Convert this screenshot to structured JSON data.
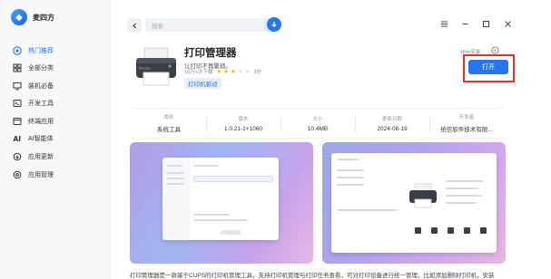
{
  "colors": {
    "accent": "#2775ee",
    "highlight_frame": "#e0302f",
    "star": "#f6b300"
  },
  "brand": {
    "name": "麦四方"
  },
  "sidebar": {
    "items": [
      {
        "label": "热门推荐",
        "icon": "star-badge-icon",
        "active": true
      },
      {
        "label": "全部分类",
        "icon": "grid-icon",
        "active": false
      },
      {
        "label": "装机必备",
        "icon": "monitor-icon",
        "active": false
      },
      {
        "label": "开发工具",
        "icon": "code-icon",
        "active": false
      },
      {
        "label": "终端应用",
        "icon": "terminal-icon",
        "active": false
      },
      {
        "label": "AI智能体",
        "icon": "ai-icon",
        "active": false
      },
      {
        "label": "应用更新",
        "icon": "refresh-icon",
        "active": false
      },
      {
        "label": "应用管理",
        "icon": "gear-icon",
        "active": false
      }
    ]
  },
  "topbar": {
    "search_placeholder": "搜索"
  },
  "app": {
    "name": "打印管理器",
    "description": "让打印不再繁琐。",
    "install_count": "10万+次下载",
    "rating": 3,
    "rating_max": 5,
    "rating_count": "3分",
    "tag": "打印机驱动",
    "web_install": "Web安装",
    "open_label": "打开"
  },
  "info": [
    {
      "label": "类别",
      "value": "系统工具"
    },
    {
      "label": "版本",
      "value": "1.0.21-1+1060"
    },
    {
      "label": "大小",
      "value": "10.4MB"
    },
    {
      "label": "更新日期",
      "value": "2024-08-19"
    },
    {
      "label": "开发者",
      "value": "统信软件技术有限..."
    }
  ],
  "description_text": "打印管理器是一款基于CUPS的打印机管理工具，支持打印机管理与打印任务查看，可对打印设备进行统一管理，比如添加删除打印机，安装"
}
